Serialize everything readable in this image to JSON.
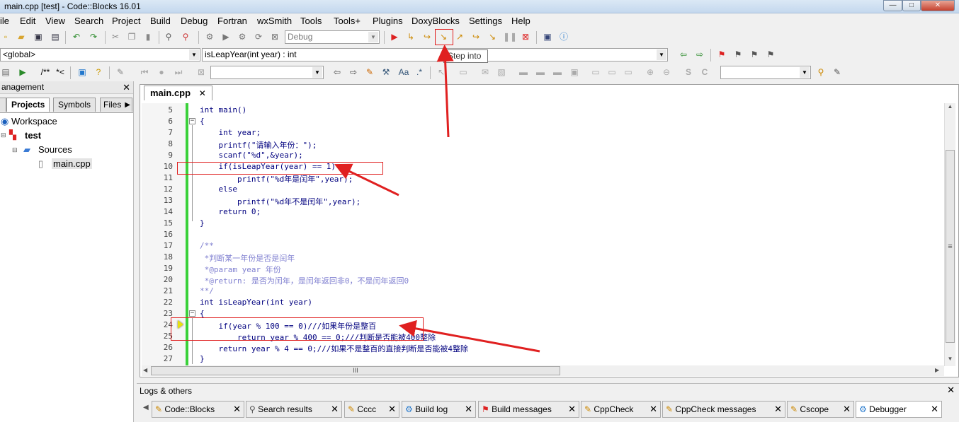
{
  "window": {
    "title": "main.cpp [test] - Code::Blocks 16.01",
    "minimize": "—",
    "maximize": "□",
    "close": "✕"
  },
  "menu": [
    "ile",
    "Edit",
    "View",
    "Search",
    "Project",
    "Build",
    "Debug",
    "Fortran",
    "wxSmith",
    "Tools",
    "Tools+",
    "Plugins",
    "DoxyBlocks",
    "Settings",
    "Help"
  ],
  "toolbar": {
    "build_target": "Debug",
    "scope": "<global>",
    "function": "isLeapYear(int year) : int",
    "comment_block": "/**",
    "comment_line": "*<",
    "search_field": "",
    "search_field2": ""
  },
  "tooltip": "Step into",
  "management": {
    "title": "anagement",
    "close": "✕",
    "tabs": [
      "Projects",
      "Symbols",
      "Files"
    ],
    "files_arrow": "▶",
    "tree": {
      "workspace": "Workspace",
      "project": "test",
      "folder": "Sources",
      "file": "main.cpp"
    }
  },
  "editor": {
    "tab_label": "main.cpp",
    "tab_close": "✕",
    "lines": [
      {
        "n": "5",
        "t": "int main()"
      },
      {
        "n": "6",
        "t": "{"
      },
      {
        "n": "7",
        "t": "    int year;"
      },
      {
        "n": "8",
        "t": "    printf(\"请输入年份：\");"
      },
      {
        "n": "9",
        "t": "    scanf(\"%d\",&year);"
      },
      {
        "n": "10",
        "t": "    if(isLeapYear(year) == 1)"
      },
      {
        "n": "11",
        "t": "        printf(\"%d年是闰年\",year);"
      },
      {
        "n": "12",
        "t": "    else"
      },
      {
        "n": "13",
        "t": "        printf(\"%d年不是闰年\",year);"
      },
      {
        "n": "14",
        "t": "    return 0;"
      },
      {
        "n": "15",
        "t": "}"
      },
      {
        "n": "16",
        "t": ""
      },
      {
        "n": "17",
        "t": "/**"
      },
      {
        "n": "18",
        "t": " *判断某一年份是否是闰年"
      },
      {
        "n": "19",
        "t": " *@param year 年份"
      },
      {
        "n": "20",
        "t": " *@return: 是否为闰年，是闰年返回非0，不是闰年返回0"
      },
      {
        "n": "21",
        "t": "**/"
      },
      {
        "n": "22",
        "t": "int isLeapYear(int year)"
      },
      {
        "n": "23",
        "t": "{"
      },
      {
        "n": "24",
        "t": "    if(year % 100 == 0)///如果年份是整百"
      },
      {
        "n": "25",
        "t": "        return year % 400 == 0;///判断是否能被400整除"
      },
      {
        "n": "26",
        "t": "    return year % 4 == 0;///如果不是整百的直接判断是否能被4整除"
      },
      {
        "n": "27",
        "t": "}"
      }
    ],
    "hscroll_grip": "III",
    "vscroll_grip": "≡"
  },
  "logs": {
    "title": "Logs & others",
    "close": "✕",
    "tabs": [
      "Code::Blocks",
      "Search results",
      "Cccc",
      "Build log",
      "Build messages",
      "CppCheck",
      "CppCheck messages",
      "Cscope",
      "Debugger"
    ],
    "tab_close": "✕"
  },
  "colors": {
    "accent_green": "#3ad13a",
    "annotation_red": "#e02020"
  }
}
